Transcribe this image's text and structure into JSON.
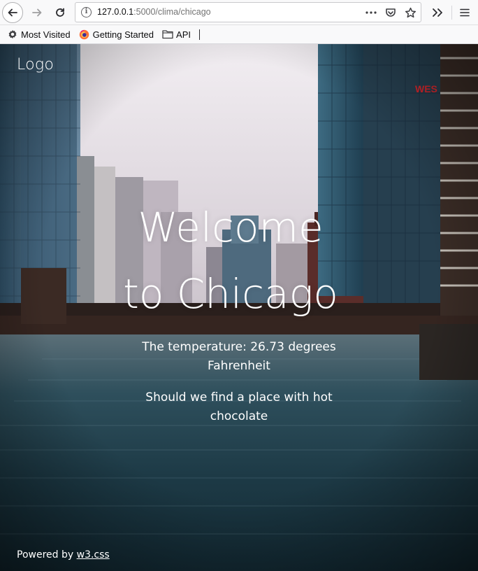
{
  "browser": {
    "url_host": "127.0.0.1",
    "url_rest": ":5000/clima/chicago",
    "bookmarks": [
      {
        "label": "Most Visited",
        "icon": "gear-icon"
      },
      {
        "label": "Getting Started",
        "icon": "firefox-icon"
      },
      {
        "label": "API",
        "icon": "folder-icon"
      }
    ]
  },
  "page": {
    "logo": "Logo",
    "title_line1": "Welcome",
    "title_line2": "to Chicago",
    "temperature_text": "The temperature: 26.73 degrees Fahrenheit",
    "suggestion_text": "Should we find a place with hot chocolate",
    "footer_prefix": "Powered by ",
    "footer_link": "w3.css"
  },
  "colors": {
    "sky": "#e9e4ea",
    "water": "#23404c",
    "text": "#ffffff"
  }
}
